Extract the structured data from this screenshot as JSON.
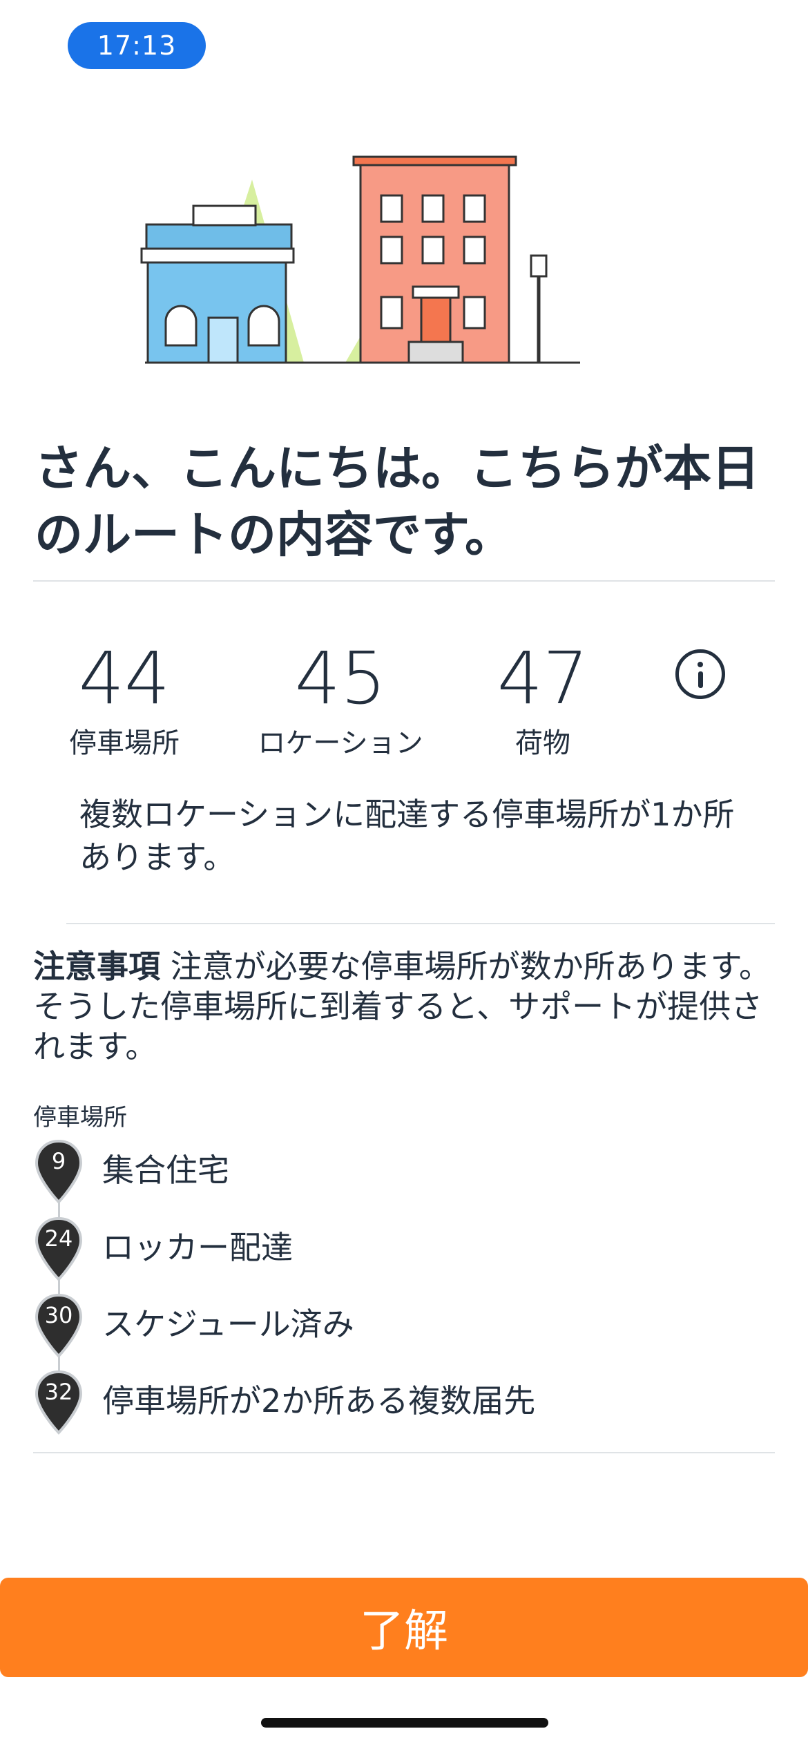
{
  "status_bar": {
    "time": "17:13"
  },
  "headline": "さん、こんにちは。こちらが本日のルートの内容です。",
  "stats": [
    {
      "value": "44",
      "label": "停車場所"
    },
    {
      "value": "45",
      "label": "ロケーション"
    },
    {
      "value": "47",
      "label": "荷物"
    }
  ],
  "note": "複数ロケーションに配達する停車場所が1か所あります。",
  "attention": {
    "title": "注意事項",
    "text": "注意が必要な停車場所が数か所あります。そうした停車場所に到着すると、サポートが提供されます。"
  },
  "stops_caption": "停車場所",
  "stops": [
    {
      "number": "9",
      "label": "集合住宅"
    },
    {
      "number": "24",
      "label": "ロッカー配達"
    },
    {
      "number": "30",
      "label": "スケジュール済み"
    },
    {
      "number": "32",
      "label": "停車場所が2か所ある複数届先"
    }
  ],
  "button_label": "了解",
  "colors": {
    "accent": "#ff7f1e",
    "status_pill": "#1a73e8",
    "text": "#232f3e"
  },
  "icons": {
    "info": "info-icon",
    "illustration": "town-illustration",
    "pin": "map-pin-icon"
  }
}
